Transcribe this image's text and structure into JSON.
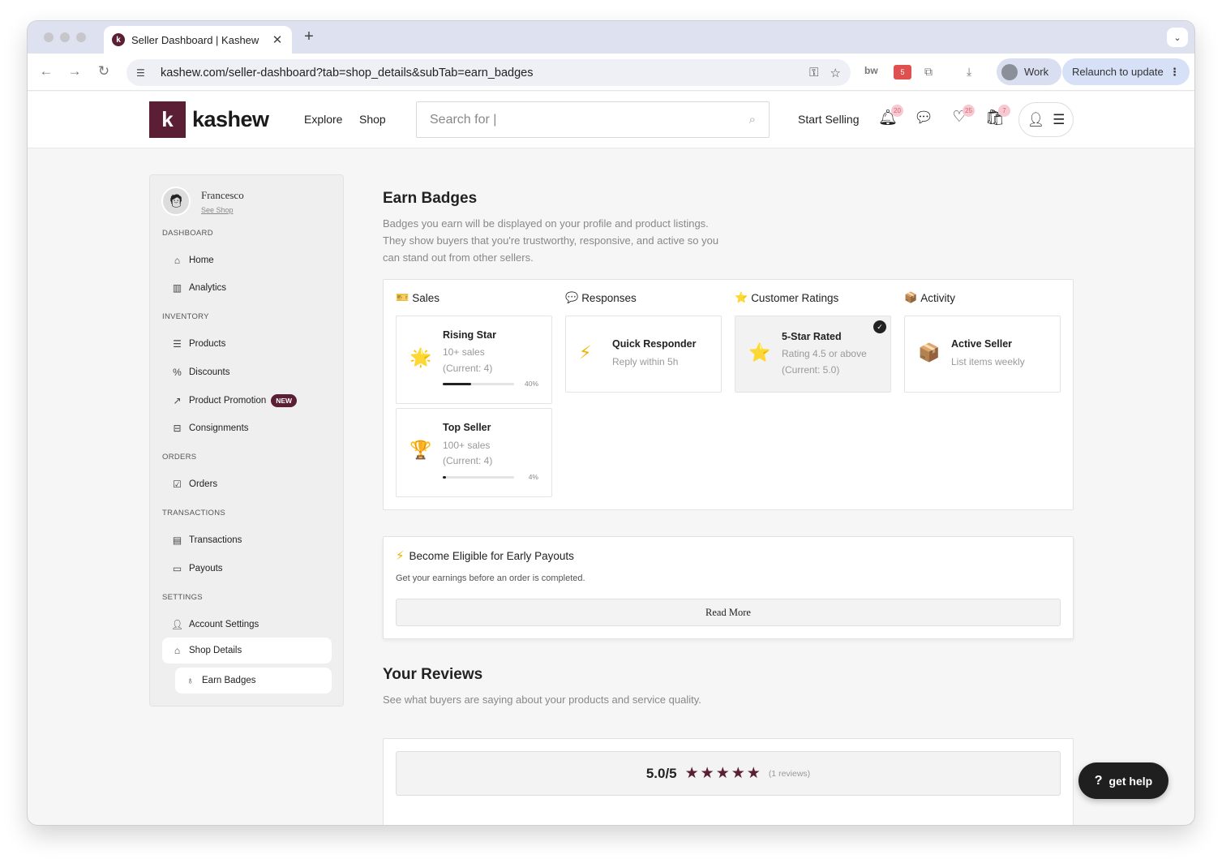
{
  "browser": {
    "tab_title": "Seller Dashboard | Kashew",
    "tab_favicon": "k",
    "tab_close": "✕",
    "new_tab": "+",
    "url": "kashew.com/seller-dashboard?tab=shop_details&subTab=earn_badges",
    "profile_label": "Work",
    "relaunch_label": "Relaunch to update",
    "ext_count": "5"
  },
  "header": {
    "logo_mark": "k",
    "logo_text": "kashew",
    "nav": [
      "Explore",
      "Shop"
    ],
    "search_placeholder": "Search for |",
    "start_selling": "Start Selling",
    "notif_count": "20",
    "favorites_count": "25",
    "cart_count": "7"
  },
  "sidebar": {
    "seller_name": "Francesco",
    "see_shop": "See Shop",
    "sections": {
      "dashboard": "DASHBOARD",
      "inventory": "INVENTORY",
      "orders": "ORDERS",
      "transactions": "TRANSACTIONS",
      "settings": "SETTINGS"
    },
    "items": {
      "home": "Home",
      "analytics": "Analytics",
      "products": "Products",
      "discounts": "Discounts",
      "product_promotion": "Product Promotion",
      "new_badge": "NEW",
      "consignments": "Consignments",
      "orders": "Orders",
      "transactions": "Transactions",
      "payouts": "Payouts",
      "account_settings": "Account Settings",
      "shop_details": "Shop Details",
      "earn_badges": "Earn Badges"
    }
  },
  "earn_badges": {
    "title": "Earn Badges",
    "description": "Badges you earn will be displayed on your profile and product listings. They show buyers that you're trustworthy, responsive, and active so you can stand out from other sellers.",
    "columns": {
      "sales": "Sales",
      "responses": "Responses",
      "ratings": "Customer Ratings",
      "activity": "Activity"
    },
    "badges": {
      "rising_star": {
        "title": "Rising Star",
        "line1": "10+ sales",
        "line2": "(Current: 4)",
        "progress_pct": "40%",
        "progress": 0.4
      },
      "top_seller": {
        "title": "Top Seller",
        "line1": "100+ sales",
        "line2": "(Current: 4)",
        "progress_pct": "4%",
        "progress": 0.04
      },
      "quick_responder": {
        "title": "Quick Responder",
        "line1": "Reply within 5h"
      },
      "five_star": {
        "title": "5-Star Rated",
        "line1": "Rating 4.5 or above",
        "line2": "(Current: 5.0)",
        "earned": true
      },
      "active_seller": {
        "title": "Active Seller",
        "line1": "List items weekly"
      }
    }
  },
  "payouts_promo": {
    "title": "Become Eligible for Early Payouts",
    "description": "Get your earnings before an order is completed.",
    "button": "Read More"
  },
  "reviews": {
    "title": "Your Reviews",
    "description": "See what buyers are saying about your products and service quality.",
    "score": "5.0/5",
    "stars": "★★★★★",
    "count": "(1 reviews)"
  },
  "help": {
    "label": "get help",
    "icon": "?"
  },
  "colors": {
    "brand": "#5b1f35"
  }
}
